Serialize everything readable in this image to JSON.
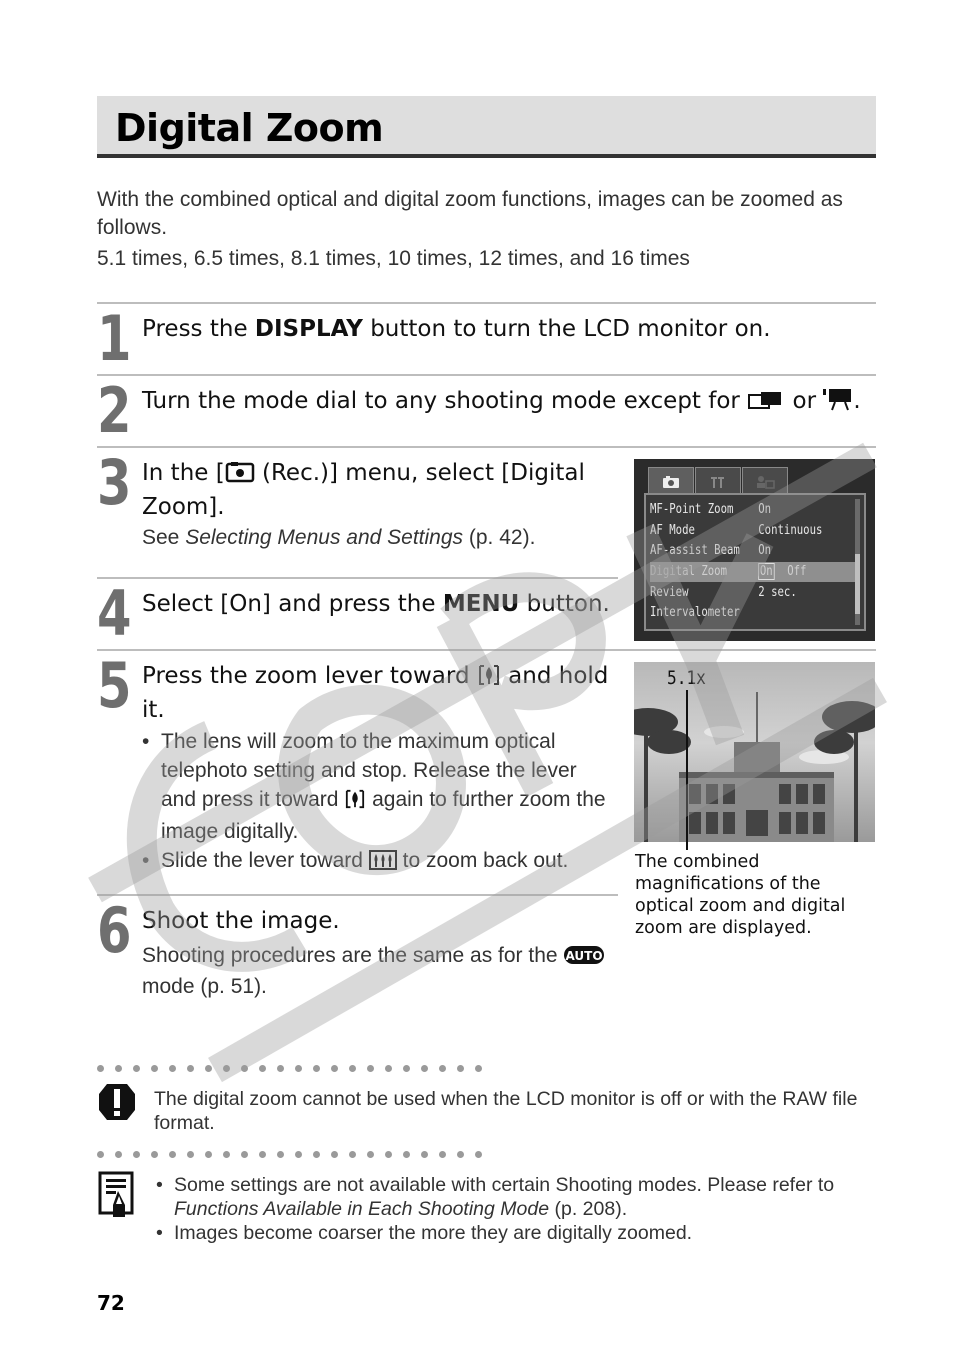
{
  "page": {
    "title": "Digital Zoom",
    "page_number": "72"
  },
  "intro": {
    "line1": "With the combined optical and digital zoom functions, images can be zoomed as follows.",
    "line2": "5.1 times, 6.5 times, 8.1 times, 10 times,  12 times, and 16 times"
  },
  "steps": [
    {
      "number": "1",
      "pre": "Press the ",
      "bold": "DISPLAY",
      "post": " button to turn the LCD monitor on."
    },
    {
      "number": "2",
      "text": "Turn the mode dial to any shooting mode except for",
      "or": "or",
      "end": ".",
      "icons": [
        "stitch-assist-icon",
        "movie-icon"
      ]
    },
    {
      "number": "3",
      "pre": "In the [",
      "post": " (Rec.)] menu, select [Digital Zoom].",
      "sub_pre": "See ",
      "sub_italic": "Selecting Menus and Settings",
      "sub_post": " (p. 42)."
    },
    {
      "number": "4",
      "pre": "Select [On] and press the ",
      "bold": "MENU",
      "post": " button."
    },
    {
      "number": "5",
      "pre": "Press the zoom lever toward ",
      "post": " and hold it.",
      "bullets": [
        {
          "pre": "The lens will zoom to the maximum optical telephoto setting and stop. Release the lever and press it toward ",
          "post": " again to further zoom the image digitally."
        },
        {
          "pre": "Slide the lever toward ",
          "post": " to zoom back out."
        }
      ]
    },
    {
      "number": "6",
      "head": "Shoot the image.",
      "sub_pre": "Shooting procedures are the same as for the ",
      "sub_post": " mode (p. 51)."
    }
  ],
  "lcd_menu": {
    "tabs": [
      "camera-tab",
      "setup-tab",
      "my-camera-tab"
    ],
    "rows": [
      {
        "label": "MF-Point Zoom",
        "value": "On"
      },
      {
        "label": "AF Mode",
        "value": "Continuous"
      },
      {
        "label": "AF-assist Beam",
        "value": "On"
      },
      {
        "label": "Digital Zoom",
        "value_on": "On",
        "value_off": "Off",
        "selected": true
      },
      {
        "label": "Review",
        "value": "2 sec."
      },
      {
        "label": "Intervalometer",
        "value": ""
      }
    ]
  },
  "photo": {
    "zoom_readout": "5.1x",
    "caption": "The combined magnifications of the optical zoom and digital zoom are displayed."
  },
  "notes": {
    "caution": "The digital zoom cannot be used when the LCD monitor is off or with the RAW file format.",
    "memo_items": [
      {
        "pre": "Some settings are not available with certain Shooting modes. Please refer to ",
        "italic": "Functions Available in Each Shooting Mode",
        "post": " (p. 208)."
      },
      {
        "pre": "Images become coarser the more they are digitally zoomed.",
        "italic": "",
        "post": ""
      }
    ]
  },
  "watermark": "COPY"
}
